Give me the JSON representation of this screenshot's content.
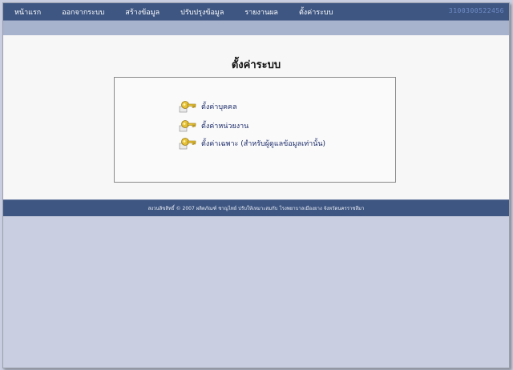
{
  "nav": {
    "items": [
      {
        "label": "หน้าแรก"
      },
      {
        "label": "ออกจากระบบ"
      },
      {
        "label": "สร้างข้อมูล"
      },
      {
        "label": "ปรับปรุงข้อมูล"
      },
      {
        "label": "รายงานผล"
      },
      {
        "label": "ตั้งค่าระบบ"
      }
    ],
    "id_number": "3100300522456"
  },
  "page": {
    "title": "ตั้งค่าระบบ"
  },
  "menu": {
    "items": [
      {
        "label": "ตั้งค่าบุคคล"
      },
      {
        "label": "ตั้งค่าหน่วยงาน"
      },
      {
        "label": "ตั้งค่าเฉพาะ (สำหรับผู้ดูแลข้อมูลเท่านั้น)"
      }
    ]
  },
  "footer": {
    "text": "สงวนลิขสิทธิ์ © 2007 ผลิตภัณฑ์ ชาญไทย์ ปรับให้เหมาะสมกับ โรงพยาบาลเมืองยาง จังหวัดนครราชสีมา"
  },
  "colors": {
    "navbar": "#3e5682",
    "subbar": "#a7b2cd",
    "background": "#c9cfe0",
    "content": "#f7f7f7",
    "link": "#1c2c6a"
  },
  "icons": {
    "menu_item": "key-icon"
  }
}
